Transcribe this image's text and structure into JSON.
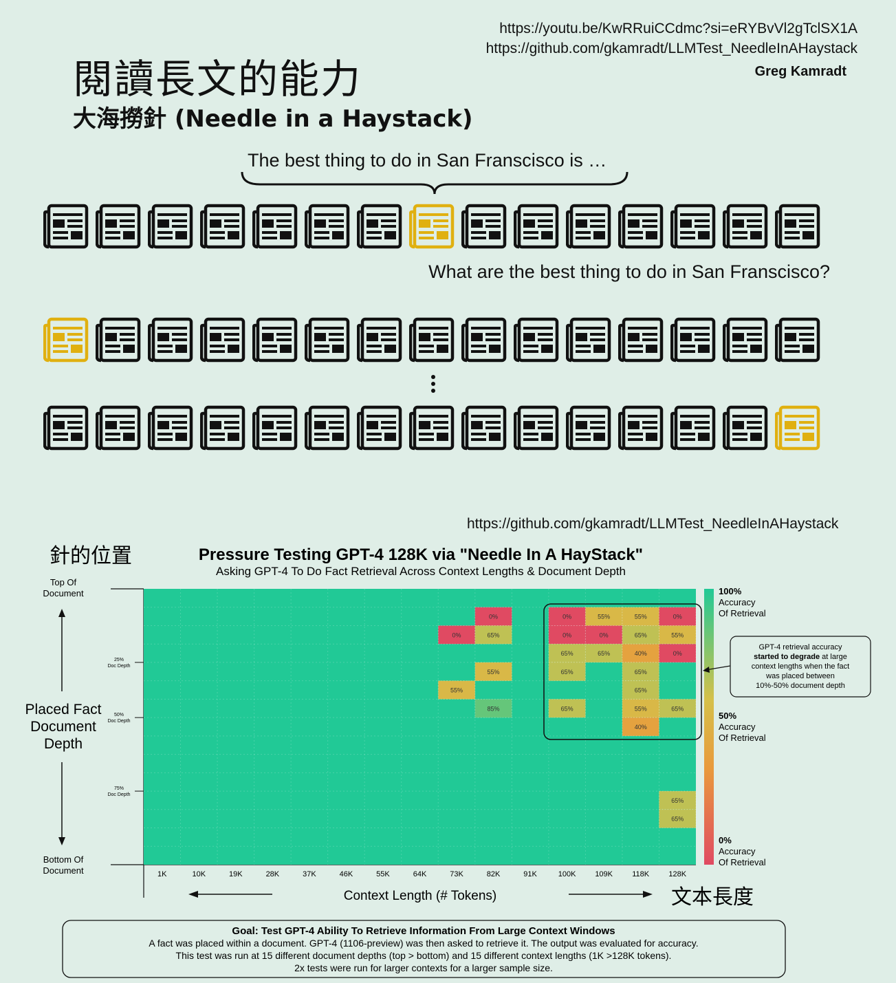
{
  "header": {
    "youtube_url": "https://youtu.be/KwRRuiCCdmc?si=eRYBvVl2gTclSX1A",
    "github_url": "https://github.com/gkamradt/LLMTest_NeedleInAHaystack",
    "author": "Greg Kamradt",
    "title": "閱讀長文的能力",
    "subtitle": "大海撈針 (Needle in a Haystack)"
  },
  "illustration": {
    "prompt": "The best thing to do in San Franscisco is …",
    "question": "What are the best thing to do in San Franscisco?",
    "rows": [
      {
        "count": 15,
        "highlight_index": 7
      },
      {
        "count": 15,
        "highlight_index": 0
      },
      {
        "count": 15,
        "highlight_index": 14
      }
    ],
    "icons": {
      "document": "newspaper-icon",
      "ellipsis": "vertical-ellipsis-icon"
    },
    "colors": {
      "document": "#111111",
      "needle_document": "#e0b010"
    }
  },
  "chart_source_url": "https://github.com/gkamradt/LLMTest_NeedleInAHaystack",
  "cn_labels": {
    "needle_position": "針的位置",
    "text_length": "文本長度"
  },
  "chart_data": {
    "type": "heatmap",
    "title": "Pressure Testing GPT-4 128K via \"Needle In A HayStack\"",
    "subtitle": "Asking GPT-4 To Do Fact Retrieval Across Context Lengths & Document Depth",
    "xlabel": "Context Length (# Tokens)",
    "ylabel": "Placed Fact Document Depth",
    "x_ticks": [
      "1K",
      "10K",
      "19K",
      "28K",
      "37K",
      "46K",
      "55K",
      "64K",
      "73K",
      "82K",
      "91K",
      "100K",
      "109K",
      "118K",
      "128K"
    ],
    "y_top_label": "Top Of Document",
    "y_bottom_label": "Bottom Of Document",
    "y_tick_labels": [
      {
        "row": 4,
        "pct": "25%",
        "text": "Doc Depth"
      },
      {
        "row": 7,
        "pct": "50%",
        "text": "Doc Depth"
      },
      {
        "row": 11,
        "pct": "75%",
        "text": "Doc Depth"
      }
    ],
    "rows": 15,
    "default_value": 100,
    "cells": [
      {
        "row": 1,
        "col": 9,
        "value": 0
      },
      {
        "row": 1,
        "col": 11,
        "value": 0
      },
      {
        "row": 1,
        "col": 12,
        "value": 55
      },
      {
        "row": 1,
        "col": 13,
        "value": 55
      },
      {
        "row": 1,
        "col": 14,
        "value": 0
      },
      {
        "row": 2,
        "col": 8,
        "value": 0
      },
      {
        "row": 2,
        "col": 9,
        "value": 65
      },
      {
        "row": 2,
        "col": 11,
        "value": 0
      },
      {
        "row": 2,
        "col": 12,
        "value": 0
      },
      {
        "row": 2,
        "col": 13,
        "value": 65
      },
      {
        "row": 2,
        "col": 14,
        "value": 55
      },
      {
        "row": 3,
        "col": 11,
        "value": 65
      },
      {
        "row": 3,
        "col": 12,
        "value": 65
      },
      {
        "row": 3,
        "col": 13,
        "value": 40
      },
      {
        "row": 3,
        "col": 14,
        "value": 0
      },
      {
        "row": 4,
        "col": 9,
        "value": 55
      },
      {
        "row": 4,
        "col": 11,
        "value": 65
      },
      {
        "row": 4,
        "col": 13,
        "value": 65
      },
      {
        "row": 5,
        "col": 8,
        "value": 55
      },
      {
        "row": 5,
        "col": 13,
        "value": 65
      },
      {
        "row": 6,
        "col": 9,
        "value": 85
      },
      {
        "row": 6,
        "col": 11,
        "value": 65
      },
      {
        "row": 6,
        "col": 13,
        "value": 55
      },
      {
        "row": 6,
        "col": 14,
        "value": 65
      },
      {
        "row": 7,
        "col": 13,
        "value": 40
      },
      {
        "row": 11,
        "col": 14,
        "value": 65
      },
      {
        "row": 12,
        "col": 14,
        "value": 65
      }
    ],
    "colorbar": {
      "colors": [
        "#e04a62",
        "#e99a3c",
        "#d5c04a",
        "#21c996"
      ],
      "labels": [
        {
          "pct": "100%",
          "text": [
            "Accuracy",
            "Of Retrieval"
          ]
        },
        {
          "pct": "50%",
          "text": [
            "Accuracy",
            "Of Retrieval"
          ]
        },
        {
          "pct": "0%",
          "text": [
            "Accuracy",
            "Of Retrieval"
          ]
        }
      ]
    },
    "annotation": [
      "GPT-4 retrieval accuracy",
      "started to degrade",
      "at large",
      "context lengths when the fact",
      "was placed between",
      "10%-50% document depth"
    ],
    "goal": {
      "title": "Goal: Test GPT-4 Ability To Retrieve Information From Large Context Windows",
      "lines": [
        "A fact was placed within a document. GPT-4 (1106-preview) was then asked to retrieve it. The output was evaluated for accuracy.",
        "This test was run at 15 different document depths (top > bottom) and 15 different context lengths (1K >128K tokens).",
        "2x tests were run for larger contexts for a larger sample size."
      ]
    }
  }
}
